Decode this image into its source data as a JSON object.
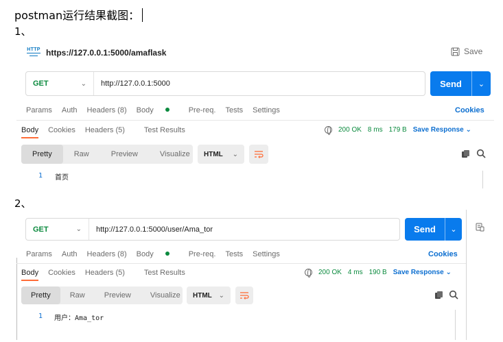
{
  "doc": {
    "title": "postman运行结果截图：",
    "step1": "1、",
    "step2": "2、"
  },
  "req1": {
    "tab_title": "https://127.0.0.1:5000/amaflask",
    "http_badge": "HTTP",
    "save_label": "Save",
    "method": "GET",
    "url": "http://127.0.0.1:5000",
    "send_label": "Send",
    "tabs": [
      "Params",
      "Auth",
      "Headers (8)",
      "Body",
      "Pre-req.",
      "Tests",
      "Settings"
    ],
    "cookies_label": "Cookies",
    "resp_tabs": [
      "Body",
      "Cookies",
      "Headers (5)",
      "Test Results"
    ],
    "status_code": "200 OK",
    "time": "8 ms",
    "size": "179 B",
    "save_response": "Save Response",
    "view_modes": [
      "Pretty",
      "Raw",
      "Preview",
      "Visualize"
    ],
    "format": "HTML",
    "line_no": "1",
    "line_text": "首页"
  },
  "req2": {
    "method": "GET",
    "url": "http://127.0.0.1:5000/user/Ama_tor",
    "send_label": "Send",
    "tabs": [
      "Params",
      "Auth",
      "Headers (8)",
      "Body",
      "Pre-req.",
      "Tests",
      "Settings"
    ],
    "cookies_label": "Cookies",
    "resp_tabs": [
      "Body",
      "Cookies",
      "Headers (5)",
      "Test Results"
    ],
    "status_code": "200 OK",
    "time": "4 ms",
    "size": "190 B",
    "save_response": "Save Response",
    "view_modes": [
      "Pretty",
      "Raw",
      "Preview",
      "Visualize"
    ],
    "format": "HTML",
    "line_no": "1",
    "line_text": "用户：Ama_tor"
  },
  "colors": {
    "accent_blue": "#097bed",
    "method_green": "#0b8a3e",
    "link_blue": "#0b6ed0",
    "active_tab_orange": "#ff6c37"
  }
}
